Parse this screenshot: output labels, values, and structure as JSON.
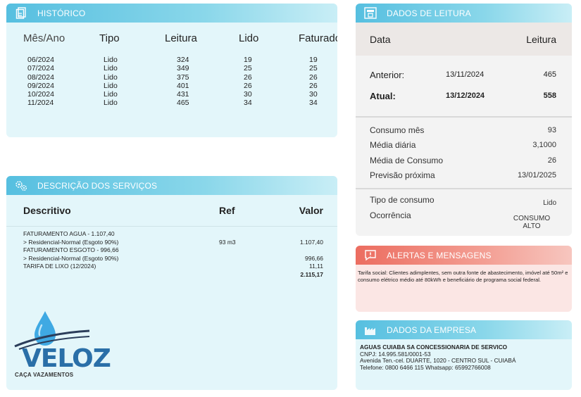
{
  "historico": {
    "title": "HISTÓRICO",
    "columns": [
      "Mês/Ano",
      "Tipo",
      "Leitura",
      "Lido",
      "Faturado"
    ],
    "rows": [
      [
        "06/2024",
        "Lido",
        "324",
        "19",
        "19"
      ],
      [
        "07/2024",
        "Lido",
        "349",
        "25",
        "25"
      ],
      [
        "08/2024",
        "Lido",
        "375",
        "26",
        "26"
      ],
      [
        "09/2024",
        "Lido",
        "401",
        "26",
        "26"
      ],
      [
        "10/2024",
        "Lido",
        "431",
        "30",
        "30"
      ],
      [
        "11/2024",
        "Lido",
        "465",
        "34",
        "34"
      ]
    ]
  },
  "servicos": {
    "title": "DESCRIÇÃO DOS SERVIÇOS",
    "columns": [
      "Descritivo",
      "Ref",
      "Valor"
    ],
    "rows": [
      [
        "FATURAMENTO AGUA - 1.107,40",
        "",
        ""
      ],
      [
        "> Residencial-Normal (Esgoto 90%)",
        "93 m3",
        "1.107,40"
      ],
      [
        "FATURAMENTO ESGOTO - 996,66",
        "",
        ""
      ],
      [
        "> Residencial-Normal (Esgoto 90%)",
        "",
        "996,66"
      ],
      [
        "TARIFA DE LIXO (12/2024)",
        "",
        "11,11"
      ],
      [
        "",
        "",
        "2.115,17"
      ]
    ]
  },
  "logo": {
    "word": "VELOZ",
    "tagline": "CAÇA VAZAMENTOS"
  },
  "leitura": {
    "title": "DADOS DE LEITURA",
    "header": [
      "Data",
      "Leitura"
    ],
    "anterior": {
      "label": "Anterior:",
      "date": "13/11/2024",
      "value": "465"
    },
    "atual": {
      "label": "Atual:",
      "date": "13/12/2024",
      "value": "558"
    },
    "stats": [
      {
        "label": "Consumo mês",
        "value": "93"
      },
      {
        "label": "Média diária",
        "value": "3,1000"
      },
      {
        "label": "Média de Consumo",
        "value": "26"
      },
      {
        "label": "Previsão próxima",
        "value": "13/01/2025"
      }
    ],
    "tipo": {
      "label": "Tipo de consumo",
      "value": "Lido"
    },
    "ocorrencia": {
      "label": "Ocorrência",
      "value_line1": "CONSUMO",
      "value_line2": "ALTO"
    }
  },
  "alertas": {
    "title": "ALERTAS E MENSAGENS",
    "text": "Tarifa social: Clientes adimplentes, sem outra fonte de abastecimento, imóvel até 50m² e consumo elétrico médio até 80kWh e beneficiário de programa social federal."
  },
  "empresa": {
    "title": "DADOS DA EMPRESA",
    "name": "AGUAS CUIABA SA CONCESSIONARIA DE SERVICO",
    "cnpj": "CNPJ: 14.995.581/0001-53",
    "address": "Avenida Ten.-cel. DUARTE, 1020 - CENTRO SUL - CUIABÁ",
    "phone": "Telefone: 0800 6466 115 Whatsapp: 65992766008"
  },
  "colors": {
    "header_blue": "#56bfe0",
    "header_red": "#ec6d60",
    "card_blue": "#e3f6fa",
    "logo_blue": "#2a6fa8"
  }
}
